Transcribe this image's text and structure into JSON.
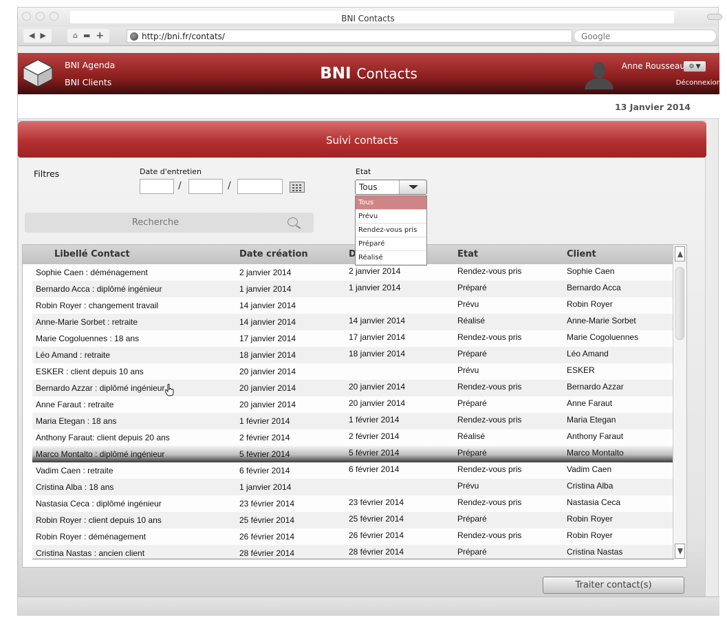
{
  "browser": {
    "title": "BNI Contacts",
    "url": "http://bni.fr/contats/",
    "search_placeholder": "Google"
  },
  "app": {
    "links": [
      "BNI Agenda",
      "BNI Clients"
    ],
    "brand_bold": "BNI",
    "brand_light": "Contacts",
    "user_name": "Anne Rousseau",
    "logout": "Déconnexion",
    "date": "13 Janvier 2014",
    "accent_color": "#b53030"
  },
  "panel": {
    "title": "Suivi contacts",
    "filters_label": "Filtres",
    "date_label": "Date d'entretien",
    "etat_label": "Etat",
    "etat_selected": "Tous",
    "etat_options": [
      "Tous",
      "Prévu",
      "Rendez-vous pris",
      "Préparé",
      "Réalisé"
    ],
    "search_placeholder": "Recherche",
    "process_button": "Traiter contact(s)"
  },
  "table": {
    "columns": [
      "Libellé Contact",
      "Date création",
      "D",
      "Etat",
      "Client"
    ],
    "rows": [
      [
        "Sophie Caen : déménagement",
        "2 janvier 2014",
        "2 janvier 2014",
        "Rendez-vous pris",
        "Sophie Caen"
      ],
      [
        "Bernardo Acca : diplômé ingénieur",
        "1 janvier 2014",
        "1 janvier 2014",
        "Préparé",
        "Bernardo Acca"
      ],
      [
        "Robin Royer : changement travail",
        "14 janvier 2014",
        "",
        "Prévu",
        "Robin Royer"
      ],
      [
        "Anne-Marie Sorbet : retraite",
        "14 janvier 2014",
        "14 janvier 2014",
        "Réalisé",
        "Anne-Marie Sorbet"
      ],
      [
        "Marie Cogoluennes : 18 ans",
        "17 janvier 2014",
        "17 janvier 2014",
        "Rendez-vous pris",
        "Marie Cogoluennes"
      ],
      [
        "Léo Amand : retraite",
        "18 janvier 2014",
        "18 janvier 2014",
        "Préparé",
        "Léo Amand"
      ],
      [
        "ESKER : client depuis 10 ans",
        "20 janvier 2014",
        "",
        "Prévu",
        "ESKER"
      ],
      [
        "Bernardo Azzar : diplômé ingénieur",
        "20 janvier 2014",
        "20 janvier 2014",
        "Rendez-vous pris",
        "Bernardo Azzar"
      ],
      [
        "Anne Faraut : retraite",
        "20 janvier 2014",
        "20 janvier 2014",
        "Préparé",
        "Anne Faraut"
      ],
      [
        "Maria Etegan : 18 ans",
        "1 février 2014",
        "1 février 2014",
        "Rendez-vous pris",
        "Maria Etegan"
      ],
      [
        "Anthony Faraut: client depuis 20 ans",
        "2 février 2014",
        "2 février 2014",
        "Réalisé",
        "Anthony Faraut"
      ],
      [
        "Marco Montalto : diplômé ingénieur",
        "5 février 2014",
        "5 février 2014",
        "Préparé",
        "Marco Montalto"
      ],
      [
        "Vadim Caen : retraite",
        "6 février 2014",
        "6 février 2014",
        "Rendez-vous pris",
        "Vadim Caen"
      ],
      [
        "Cristina Alba : 18 ans",
        "1 janvier 2014",
        "",
        "Prévu",
        "Cristina Alba"
      ],
      [
        "Nastasia Ceca : diplômé ingénieur",
        "23 février 2014",
        "23 février 2014",
        "Rendez-vous pris",
        "Nastasia Ceca"
      ],
      [
        "Robin Royer : client depuis 10 ans",
        "25 février 2014",
        "25 février 2014",
        "Préparé",
        "Robin Royer"
      ],
      [
        "Robin Royer : déménagement",
        "26 février 2014",
        "26 février 2014",
        "Rendez-vous pris",
        "Robin Royer"
      ],
      [
        "Cristina Nastas : ancien client",
        "28 février 2014",
        "28 février 2014",
        "Préparé",
        "Cristina Nastas"
      ]
    ],
    "selected_row": 11
  },
  "icons": {
    "logo": "cube-logo-icon",
    "user": "user-silhouette-icon",
    "settings": "gear-icon",
    "calendar": "calendar-icon",
    "search": "search-icon",
    "cursor": "hand-cursor-icon"
  }
}
